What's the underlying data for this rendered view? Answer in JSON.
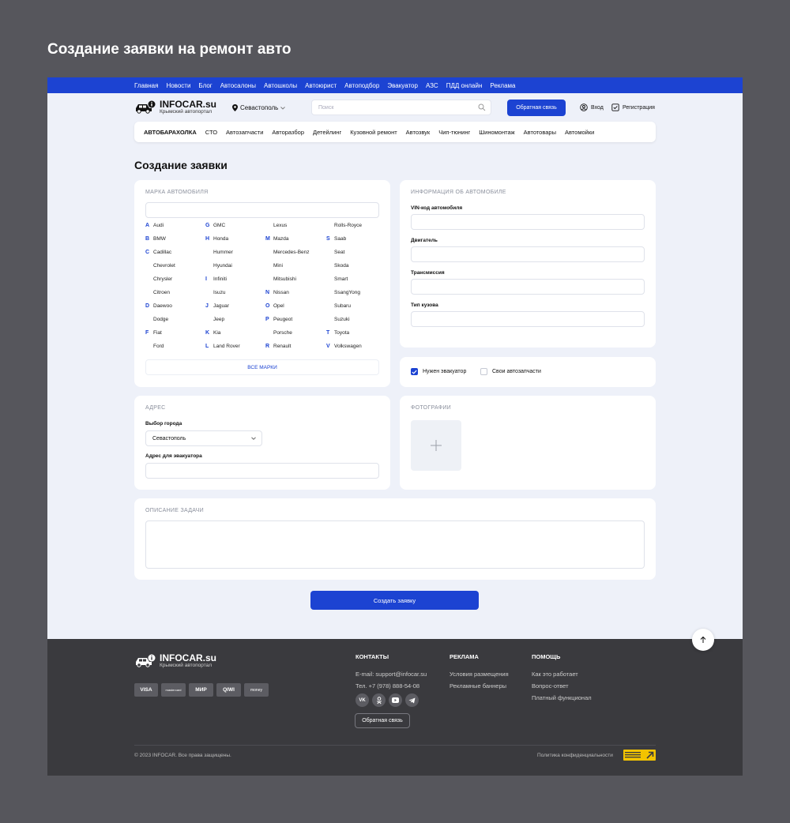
{
  "page_title": "Создание заявки на ремонт авто",
  "topnav": [
    "Главная",
    "Новости",
    "Блог",
    "Автосалоны",
    "Автошколы",
    "Автоюрист",
    "Автоподбор",
    "Эвакуатор",
    "АЗС",
    "ПДД онлайн",
    "Реклама"
  ],
  "header": {
    "logo_name": "INFOCAR.su",
    "logo_sub": "Крымский автопортал",
    "city": "Севастополь",
    "search_placeholder": "Поиск",
    "feedback": "Обратная связь",
    "login": "Вход",
    "register": "Регистрация"
  },
  "catnav": [
    "АВТОБАРАХОЛКА",
    "СТО",
    "Автозапчасти",
    "Авторазбор",
    "Детейлинг",
    "Кузовной ремонт",
    "Автозвук",
    "Чип-тюнинг",
    "Шиномонтаж",
    "Автотовары",
    "Автомойки"
  ],
  "form_title": "Создание заявки",
  "brands_card": {
    "title": "МАРКА АВТОМОБИЛЯ",
    "columns": [
      [
        {
          "l": "A",
          "n": "Audi"
        },
        {
          "l": "B",
          "n": "BMW"
        },
        {
          "l": "C",
          "n": "Cadillac"
        },
        {
          "l": "",
          "n": "Chevrolet"
        },
        {
          "l": "",
          "n": "Chrysler"
        },
        {
          "l": "",
          "n": "Citroen"
        },
        {
          "l": "D",
          "n": "Daewoo"
        },
        {
          "l": "",
          "n": "Dodge"
        },
        {
          "l": "F",
          "n": "Fiat"
        },
        {
          "l": "",
          "n": "Ford"
        }
      ],
      [
        {
          "l": "G",
          "n": "GMC"
        },
        {
          "l": "H",
          "n": "Honda"
        },
        {
          "l": "",
          "n": "Hummer"
        },
        {
          "l": "",
          "n": "Hyundai"
        },
        {
          "l": "I",
          "n": "Infiniti"
        },
        {
          "l": "",
          "n": "Isuzu"
        },
        {
          "l": "J",
          "n": "Jaguar"
        },
        {
          "l": "",
          "n": "Jeep"
        },
        {
          "l": "K",
          "n": "Kia"
        },
        {
          "l": "L",
          "n": "Land Rover"
        }
      ],
      [
        {
          "l": "",
          "n": "Lexus"
        },
        {
          "l": "M",
          "n": "Mazda"
        },
        {
          "l": "",
          "n": "Mercedes-Benz"
        },
        {
          "l": "",
          "n": "Mini"
        },
        {
          "l": "",
          "n": "Mitsubishi"
        },
        {
          "l": "N",
          "n": "Nissan"
        },
        {
          "l": "O",
          "n": "Opel"
        },
        {
          "l": "P",
          "n": "Peugeot"
        },
        {
          "l": "",
          "n": "Porsche"
        },
        {
          "l": "R",
          "n": "Renault"
        }
      ],
      [
        {
          "l": "",
          "n": "Rolls-Royce"
        },
        {
          "l": "S",
          "n": "Saab"
        },
        {
          "l": "",
          "n": "Seat"
        },
        {
          "l": "",
          "n": "Skoda"
        },
        {
          "l": "",
          "n": "Smart"
        },
        {
          "l": "",
          "n": "SsangYong"
        },
        {
          "l": "",
          "n": "Subaru"
        },
        {
          "l": "",
          "n": "Suzuki"
        },
        {
          "l": "T",
          "n": "Toyota"
        },
        {
          "l": "V",
          "n": "Volkswagen"
        }
      ]
    ],
    "all_brands": "ВСЕ МАРКИ"
  },
  "car_info": {
    "title": "ИНФОРМАЦИЯ ОБ АВТОМОБИЛЕ",
    "vin": "VIN-код автомобиля",
    "engine": "Двигатель",
    "transmission": "Трансмиссия",
    "body": "Тип кузова"
  },
  "options": {
    "tow": "Нужен эвакуатор",
    "tow_checked": true,
    "parts": "Свои автозапчасти",
    "parts_checked": false
  },
  "address": {
    "title": "АДРЕС",
    "city_label": "Выбор города",
    "city_value": "Севастополь",
    "tow_address": "Адрес для эвакуатора"
  },
  "photos": {
    "title": "ФОТОГРАФИИ"
  },
  "description": {
    "title": "ОПИСАНИЕ ЗАДАЧИ"
  },
  "submit": "Создать заявку",
  "footer": {
    "logo_name": "INFOCAR.su",
    "logo_sub": "Крымский автопортал",
    "payments": [
      "VISA",
      "mastercard",
      "МИР",
      "QIWI",
      "money"
    ],
    "contacts_title": "КОНТАКТЫ",
    "email": "E-mail: support@infocar.su",
    "phone": "Тел. +7 (978) 888-54-08",
    "feedback": "Обратная связь",
    "ads_title": "РЕКЛАМА",
    "ads": [
      "Условия размещения",
      "Рекламные баннеры"
    ],
    "help_title": "ПОМОЩЬ",
    "help": [
      "Как это работает",
      "Вопрос-ответ",
      "Платный функционал"
    ],
    "copyright": "© 2023 INFOCAR. Все права защищены.",
    "policy": "Политика конфиденциальности"
  },
  "colors": {
    "accent": "#1c43d2",
    "footer": "#3a3a3e",
    "frame_bg": "#eef1f9"
  }
}
